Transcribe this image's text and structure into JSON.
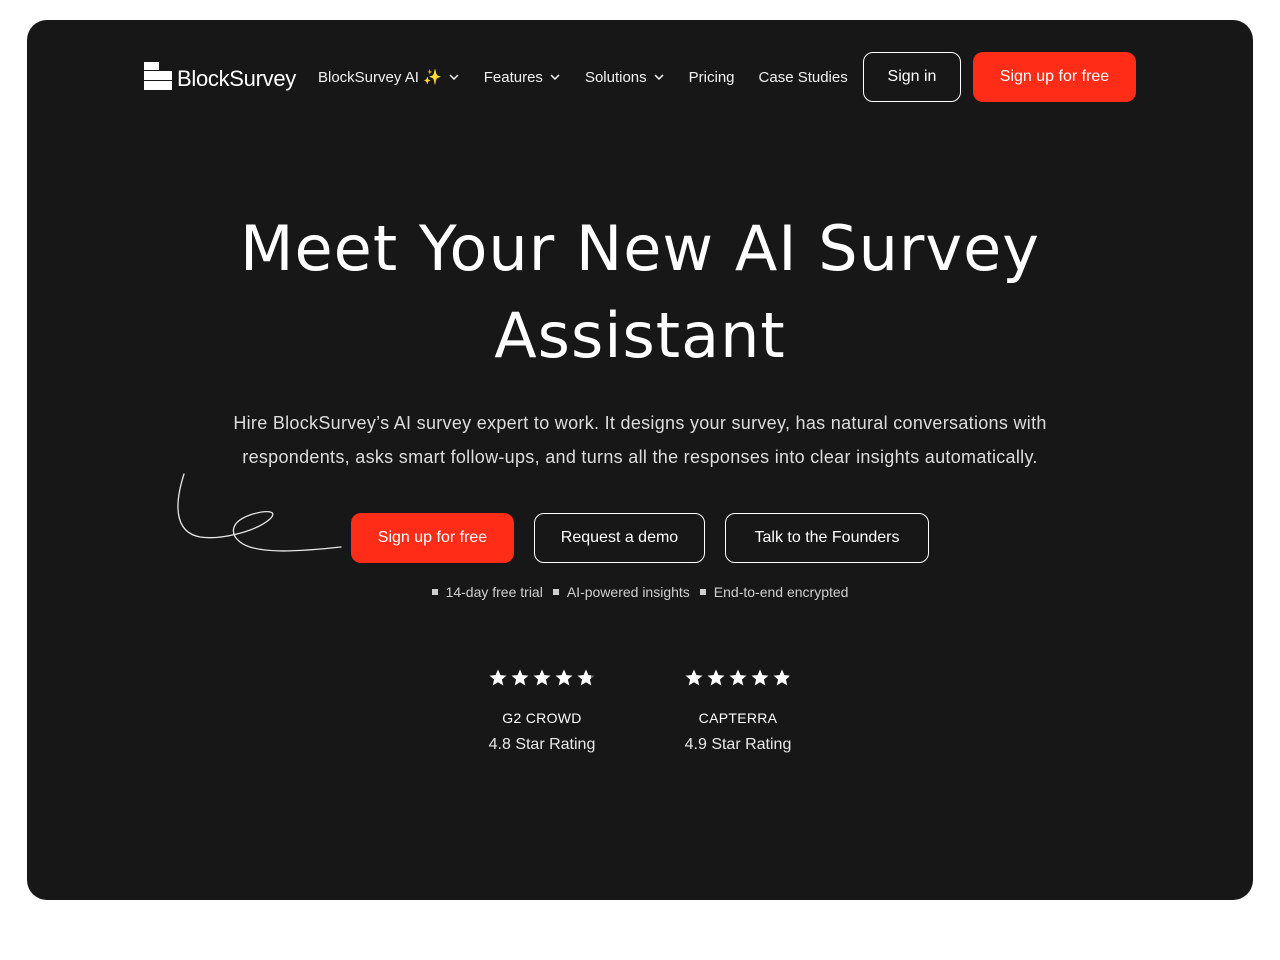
{
  "brand": {
    "name": "BlockSurvey"
  },
  "nav": {
    "items": [
      {
        "label": "BlockSurvey AI ✨",
        "has_dropdown": true
      },
      {
        "label": "Features",
        "has_dropdown": true
      },
      {
        "label": "Solutions",
        "has_dropdown": true
      },
      {
        "label": "Pricing",
        "has_dropdown": false
      },
      {
        "label": "Case Studies",
        "has_dropdown": false
      }
    ],
    "signin_label": "Sign in",
    "signup_label": "Sign up for free"
  },
  "hero": {
    "headline_line1": "Meet Your New AI Survey",
    "headline_line2": "Assistant",
    "subtext_line1": "Hire BlockSurvey’s AI survey expert to work. It designs your survey, has natural conversations with",
    "subtext_line2": "respondents, asks smart follow-ups, and turns all the responses into clear insights automatically.",
    "cta_signup": "Sign up for free",
    "cta_demo": "Request a demo",
    "cta_founders": "Talk to the Founders",
    "features": [
      "14-day free trial",
      "AI-powered insights",
      "End-to-end encrypted"
    ]
  },
  "ratings": [
    {
      "source": "G2 CROWD",
      "score_text": "4.8 Star Rating",
      "stars": 4.8
    },
    {
      "source": "CAPTERRA",
      "score_text": "4.9 Star Rating",
      "stars": 4.9
    }
  ],
  "colors": {
    "hero_bg": "#171717",
    "accent_red": "#ff2d17",
    "page_bg": "#ffffff"
  },
  "icons": {
    "dropdown": "chevron-down-icon",
    "star": "star-icon",
    "bullet": "square-bullet-icon"
  }
}
